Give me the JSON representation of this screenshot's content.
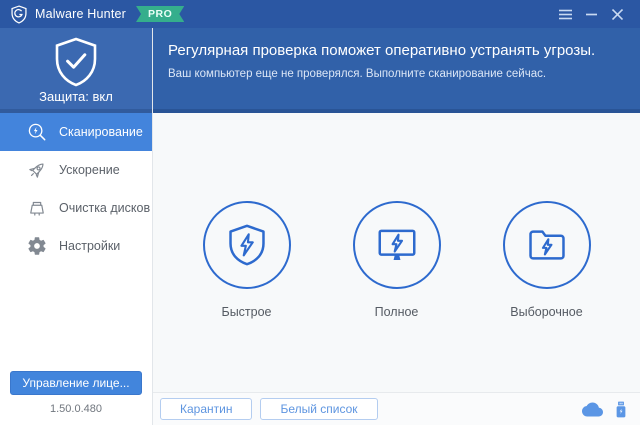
{
  "window": {
    "app_name": "Malware Hunter",
    "badge": "PRO"
  },
  "header": {
    "protection_status": "Защита: вкл",
    "title": "Регулярная проверка поможет оперативно устранять угрозы.",
    "subtitle": "Ваш компьютер еще не проверялся. Выполните сканирование сейчас."
  },
  "sidebar": {
    "items": [
      {
        "label": "Сканирование",
        "icon": "scan-icon",
        "active": true
      },
      {
        "label": "Ускорение",
        "icon": "rocket-icon",
        "active": false
      },
      {
        "label": "Очистка дисков",
        "icon": "broom-icon",
        "active": false
      },
      {
        "label": "Настройки",
        "icon": "gear-icon",
        "active": false
      }
    ],
    "license_button": "Управление лице...",
    "version": "1.50.0.480"
  },
  "main": {
    "scan_modes": [
      {
        "label": "Быстрое",
        "icon": "shield-lightning-icon"
      },
      {
        "label": "Полное",
        "icon": "monitor-lightning-icon"
      },
      {
        "label": "Выборочное",
        "icon": "folder-lightning-icon"
      }
    ]
  },
  "footer": {
    "quarantine_label": "Карантин",
    "whitelist_label": "Белый список",
    "icons": [
      "cloud-icon",
      "usb-icon"
    ]
  },
  "colors": {
    "titlebar": "#2b57a3",
    "header": "#3161a9",
    "sidebar_head": "#3b69b1",
    "active_item": "#4384dc",
    "accent_blue": "#2d6ace",
    "pro_green": "#35ae8c"
  }
}
